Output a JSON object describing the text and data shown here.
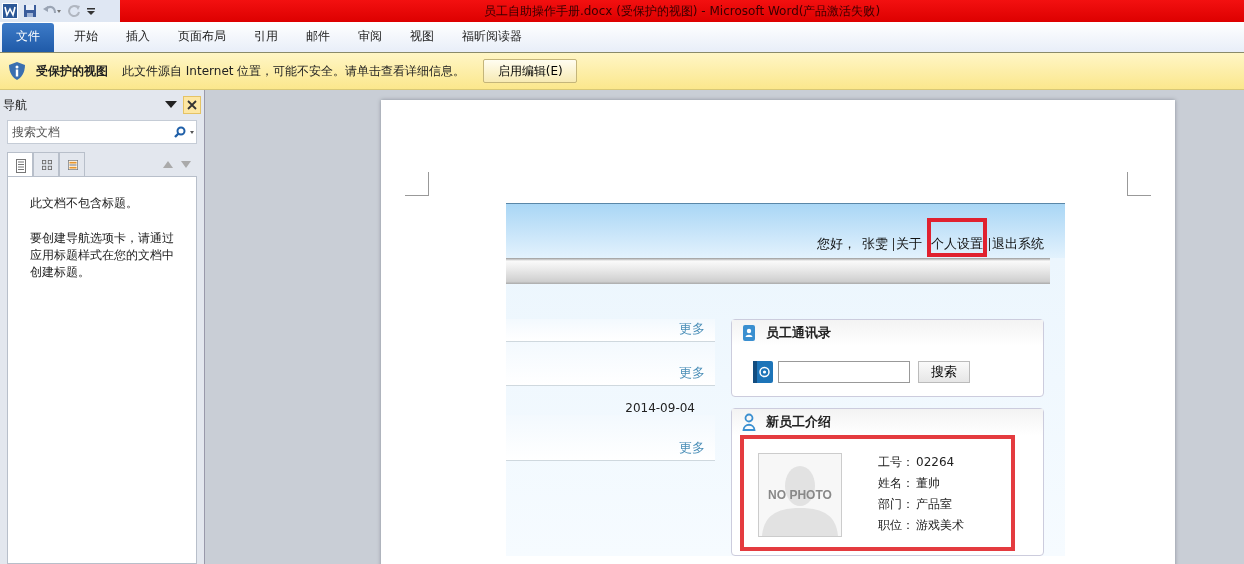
{
  "window": {
    "title": "员工自助操作手册.docx (受保护的视图)  -  Microsoft Word(产品激活失败)"
  },
  "ribbon_tabs": [
    {
      "label": "文件",
      "selected": true
    },
    {
      "label": "开始",
      "selected": false
    },
    {
      "label": "插入",
      "selected": false
    },
    {
      "label": "页面布局",
      "selected": false
    },
    {
      "label": "引用",
      "selected": false
    },
    {
      "label": "邮件",
      "selected": false
    },
    {
      "label": "审阅",
      "selected": false
    },
    {
      "label": "视图",
      "selected": false
    },
    {
      "label": "福昕阅读器",
      "selected": false
    }
  ],
  "protected_view": {
    "title": "受保护的视图",
    "message": "此文件源自 Internet 位置，可能不安全。请单击查看详细信息。",
    "button": "启用编辑(E)"
  },
  "navigation_pane": {
    "title": "导航",
    "search": {
      "placeholder": "搜索文档"
    },
    "tabs": [
      {
        "kind": "headings",
        "selected": true
      },
      {
        "kind": "pages",
        "selected": false
      },
      {
        "kind": "results",
        "selected": false
      }
    ],
    "messages": [
      "此文档不包含标题。",
      "要创建导航选项卡，请通过应用标题样式在您的文档中创建标题。"
    ]
  },
  "document": {
    "portal": {
      "greeting": "您好，",
      "user": "张雯",
      "links": [
        {
          "label": "关于",
          "highlighted": false
        },
        {
          "label": "个人设置",
          "highlighted": true
        },
        {
          "label": "退出系统",
          "highlighted": false
        }
      ],
      "left_rows": [
        {
          "kind": "more",
          "text": "更多"
        },
        {
          "kind": "more",
          "text": "更多"
        },
        {
          "kind": "date",
          "text": "2014-09-04"
        },
        {
          "kind": "more",
          "text": "更多"
        }
      ],
      "directory": {
        "title": "员工通讯录",
        "button": "搜索"
      },
      "new_employee": {
        "title": "新员工介绍",
        "highlighted": true,
        "photo_label": "NO PHOTO",
        "fields": [
          {
            "label": "工号：",
            "value": "02264"
          },
          {
            "label": "姓名：",
            "value": "董帅"
          },
          {
            "label": "部门：",
            "value": "产品室"
          },
          {
            "label": "职位：",
            "value": "游戏美术"
          }
        ]
      }
    }
  }
}
